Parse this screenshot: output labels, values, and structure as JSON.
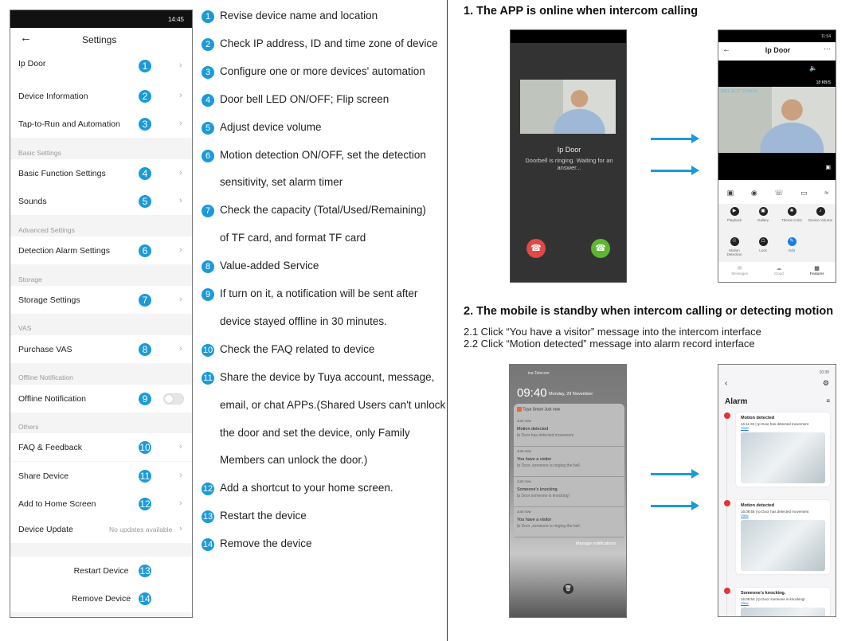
{
  "settings_phone": {
    "status_time": "14:45",
    "title": "Settings",
    "items": [
      {
        "label": "Ip Door",
        "num": "1",
        "type": "row",
        "chevron": true
      },
      {
        "label": "Device Information",
        "num": "2",
        "type": "row",
        "chevron": true
      },
      {
        "label": "Tap-to-Run and Automation",
        "num": "3",
        "type": "row",
        "chevron": true
      },
      {
        "label": "Basic Settings",
        "type": "section"
      },
      {
        "label": "Basic Function Settings",
        "num": "4",
        "type": "row",
        "chevron": true
      },
      {
        "label": "Sounds",
        "num": "5",
        "type": "row",
        "chevron": true
      },
      {
        "label": "Advanced Settings",
        "type": "section"
      },
      {
        "label": "Detection Alarm Settings",
        "num": "6",
        "type": "row",
        "chevron": true
      },
      {
        "label": "Storage",
        "type": "section"
      },
      {
        "label": "Storage Settings",
        "num": "7",
        "type": "row",
        "chevron": true
      },
      {
        "label": "VAS",
        "type": "section"
      },
      {
        "label": "Purchase VAS",
        "num": "8",
        "type": "row",
        "chevron": true
      },
      {
        "label": "Offline Notification",
        "type": "section"
      },
      {
        "label": "Offline Notification",
        "num": "9",
        "type": "toggle",
        "toggle_on": false
      },
      {
        "label": "Others",
        "type": "section"
      },
      {
        "label": "FAQ & Feedback",
        "num": "10",
        "type": "row",
        "chevron": true
      },
      {
        "label": "Share Device",
        "num": "11",
        "type": "row",
        "chevron": true
      },
      {
        "label": "Add to Home Screen",
        "num": "12",
        "type": "row",
        "chevron": true
      },
      {
        "label": "Device Update",
        "type": "row",
        "value": "No updates available",
        "chevron": true
      },
      {
        "label": "Restart Device",
        "num": "13",
        "type": "button"
      },
      {
        "label": "Remove Device",
        "num": "14",
        "type": "button"
      }
    ]
  },
  "descriptions": [
    {
      "num": "1",
      "lines": [
        "Revise device name and location"
      ]
    },
    {
      "num": "2",
      "lines": [
        "Check IP address, ID and time zone of device"
      ]
    },
    {
      "num": "3",
      "lines": [
        "Configure one or more devices' automation"
      ]
    },
    {
      "num": "4",
      "lines": [
        "Door bell LED ON/OFF; Flip screen"
      ]
    },
    {
      "num": "5",
      "lines": [
        "Adjust device volume"
      ]
    },
    {
      "num": "6",
      "lines": [
        "Motion detection ON/OFF, set the detection",
        "sensitivity, set alarm timer"
      ]
    },
    {
      "num": "7",
      "lines": [
        "Check the capacity (Total/Used/Remaining)",
        "of TF card, and format TF card"
      ]
    },
    {
      "num": "8",
      "lines": [
        "Value-added Service"
      ]
    },
    {
      "num": "9",
      "lines": [
        "If turn on it, a notification will be sent after",
        "device stayed offline in 30 minutes."
      ]
    },
    {
      "num": "10",
      "lines": [
        "Check the FAQ related to device"
      ]
    },
    {
      "num": "11",
      "lines": [
        "Share the device by Tuya account, message,",
        "email, or chat APPs.(Shared Users can't unlock",
        "the door and set the device, only Family",
        "Members can unlock the door.)"
      ]
    },
    {
      "num": "12",
      "lines": [
        "Add a shortcut to your home screen."
      ]
    },
    {
      "num": "13",
      "lines": [
        "Restart the device"
      ]
    },
    {
      "num": "14",
      "lines": [
        "Remove the device"
      ]
    }
  ],
  "section1": {
    "heading": "1. The APP is online when intercom calling",
    "call_screen": {
      "device": "Ip Door",
      "status": "Doorbell is ringing. Waiting for an answer..."
    },
    "live_screen": {
      "status_time": "11:54",
      "title": "Ip Door",
      "speed": "18 KB/S",
      "timestamp": "2021-11-27  11:54:14",
      "features": [
        "Playback",
        "Gallery",
        "Theme Color",
        "Device Volume",
        "Motion Detection",
        "Lock",
        "Edit"
      ],
      "tabs": [
        "Messages",
        "Cloud",
        "Features"
      ],
      "accent": "#1b7fe0"
    }
  },
  "section2": {
    "heading": "2. The mobile is standby when intercom calling or detecting motion",
    "steps": [
      "2.1 Click “You have a visitor” message into the intercom interface",
      "2.2 Click “Motion detected” message into alarm record interface"
    ],
    "lock_screen": {
      "carrier": "ina Telecom",
      "time": "09:40",
      "date": "Monday, 29 November",
      "app": "Tuya Smart",
      "app_time": "Just now",
      "notifications": [
        {
          "time": "Just now",
          "title": "Motion detected",
          "body": "Ip Door has detected movement"
        },
        {
          "time": "Just now",
          "title": "You have a visitor",
          "body": "Ip Door ,someone is ringing the bell."
        },
        {
          "time": "Just now",
          "title": "Someone's knocking.",
          "body": "Ip Door someone is knocking!"
        },
        {
          "time": "Just now",
          "title": "You have a visitor",
          "body": "Ip Door ,someone is ringing the bell."
        }
      ],
      "manage": "Manage notifications"
    },
    "alarm_screen": {
      "status_time": "10:30",
      "title": "Alarm",
      "events": [
        {
          "title": "Motion detected",
          "detail": "16:11:33 | Ip Door has detected movement",
          "link": "View"
        },
        {
          "title": "Motion detected",
          "detail": "16:09:55 | Ip Door has detected movement",
          "link": "View"
        },
        {
          "title": "Someone's knocking.",
          "detail": "16:08:53 | Ip Door someone is knocking!",
          "link": "View"
        }
      ]
    }
  },
  "colors": {
    "accent_blue": "#1b9ad9",
    "decline_red": "#e14848",
    "accept_green": "#5cb82e",
    "alarm_red": "#e0353b"
  }
}
